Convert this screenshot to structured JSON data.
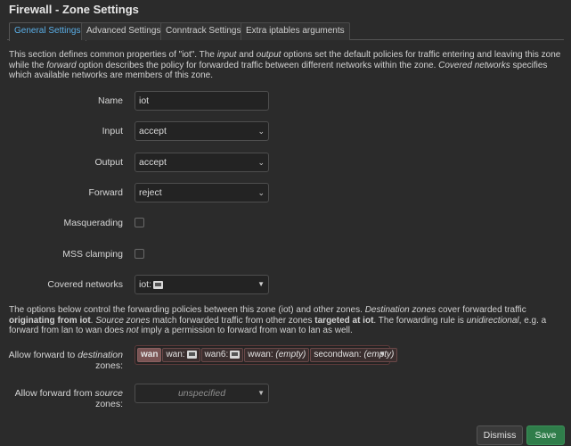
{
  "title": "Firewall - Zone Settings",
  "tabs": [
    {
      "label": "General Settings",
      "active": true
    },
    {
      "label": "Advanced Settings",
      "active": false
    },
    {
      "label": "Conntrack Settings",
      "active": false
    },
    {
      "label": "Extra iptables arguments",
      "active": false
    }
  ],
  "intro": {
    "p1": "This section defines common properties of \"iot\". The ",
    "input_em": "input",
    "p2": " and ",
    "output_em": "output",
    "p3": " options set the default policies for traffic entering and leaving this zone while the ",
    "forward_em": "forward",
    "p4": " option describes the policy for forwarded traffic between different networks within the zone. ",
    "covered_em": "Covered networks",
    "p5": " specifies which available networks are members of this zone."
  },
  "fields": {
    "name": {
      "label": "Name",
      "value": "iot"
    },
    "input": {
      "label": "Input",
      "value": "accept"
    },
    "output": {
      "label": "Output",
      "value": "accept"
    },
    "forward": {
      "label": "Forward",
      "value": "reject"
    },
    "masquerading": {
      "label": "Masquerading",
      "checked": false
    },
    "mss_clamping": {
      "label": "MSS clamping",
      "checked": false
    },
    "covered_networks": {
      "label": "Covered networks",
      "value": "iot:",
      "icon": "network-icon"
    }
  },
  "forwarding_desc": {
    "p1": "The options below control the forwarding policies between this zone (iot) and other zones. ",
    "dest_em": "Destination zones",
    "p2": " cover forwarded traffic ",
    "orig_strong": "originating from iot",
    "p3": ". ",
    "src_em": "Source zones",
    "p4": " match forwarded traffic from other zones ",
    "targ_strong": "targeted at iot",
    "p5": ". The forwarding rule is ",
    "uni_em": "unidirectional",
    "p6": ", e.g. a forward from lan to wan does ",
    "not_em": "not",
    "p7": " imply a permission to forward from wan to lan as well."
  },
  "allow_dest": {
    "label_pre": "Allow forward to ",
    "label_em": "destination",
    "label_post": " zones:",
    "zone": "wan",
    "chips": [
      {
        "name": "wan:",
        "icon": "network-icon"
      },
      {
        "name": "wan6:",
        "icon": "network-icon"
      },
      {
        "name": "wwan:",
        "empty": "(empty)"
      },
      {
        "name": "secondwan:",
        "empty": "(empty)"
      }
    ]
  },
  "allow_src": {
    "label_pre": "Allow forward from ",
    "label_em": "source",
    "label_post": " zones:",
    "value": "unspecified"
  },
  "buttons": {
    "dismiss": "Dismiss",
    "save": "Save"
  },
  "colors": {
    "accent": "#5aaee6",
    "save": "#2f7d4a",
    "zone_chip": "#7a5454"
  }
}
